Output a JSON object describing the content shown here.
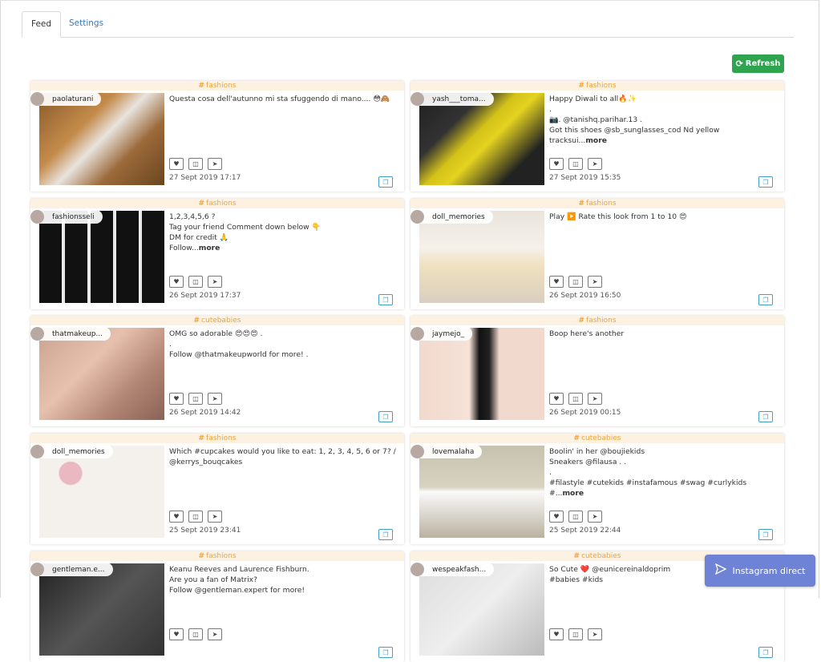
{
  "tabs": [
    {
      "label": "Feed",
      "active": true
    },
    {
      "label": "Settings",
      "active": false
    }
  ],
  "refresh_label": "Refresh",
  "instagram_direct_label": "Instagram direct",
  "colors": {
    "accent_green": "#2ea44f",
    "tag_orange": "#f2a33a",
    "tag_bg": "#fdf2e2",
    "link_blue": "#3b78b8",
    "direct_purple": "#6f83d6"
  },
  "posts": [
    {
      "tag": "fashions",
      "user": "paolaturani",
      "caption": "Questa cosa dell'autunno mi sta sfuggendo di mano.... 😳🙈",
      "more": "",
      "date": "27 Sept 2019 17:17"
    },
    {
      "tag": "fashions",
      "user": "yash___toma...",
      "caption": "Happy Diwali to all🔥✨\n.\n📷. @tanishq.parihar.13 .\nGot this shoes @sb_sunglasses_cod Nd yellow tracksui...",
      "more": "more",
      "date": "27 Sept 2019 15:35"
    },
    {
      "tag": "fashions",
      "user": "fashionsseli",
      "caption": "1,2,3,4,5,6 ?\nTag your friend Comment down below 👇\nDM for credit 🙏\nFollow...",
      "more": "more",
      "date": "26 Sept 2019 17:37"
    },
    {
      "tag": "fashions",
      "user": "doll_memories",
      "caption": "Play ▶️ Rate this look from 1 to 10 😍",
      "more": "",
      "date": "26 Sept 2019 16:50"
    },
    {
      "tag": "cutebabies",
      "user": "thatmakeup...",
      "caption": "OMG so adorable 😍😍😍 .\n.\nFollow @thatmakeupworld for more! .",
      "more": "",
      "date": "26 Sept 2019 14:42"
    },
    {
      "tag": "fashions",
      "user": "jaymejo_",
      "caption": "Boop here's another",
      "more": "",
      "date": "26 Sept 2019 00:15"
    },
    {
      "tag": "fashions",
      "user": "doll_memories",
      "caption": "Which #cupcakes would you like to eat: 1, 2, 3, 4, 5, 6 or 7? /\n@kerrys_bouqcakes",
      "more": "",
      "date": "25 Sept 2019 23:41"
    },
    {
      "tag": "cutebabies",
      "user": "lovemalaha",
      "caption": "Boolin' in her @boujiekids\nSneakers @filausa . .\n.\n#filastyle #cutekids #instafamous #swag #curlykids #...",
      "more": "more",
      "date": "25 Sept 2019 22:44"
    },
    {
      "tag": "fashions",
      "user": "gentleman.e...",
      "caption": "Keanu Reeves and Laurence Fishburn.\nAre you a fan of Matrix?\nFollow @gentleman.expert for more!",
      "more": "",
      "date": ""
    },
    {
      "tag": "cutebabies",
      "user": "wespeakfash...",
      "caption": "So Cute ❤️ @eunicereinaldoprim\n#babies #kids",
      "more": "",
      "date": ""
    }
  ]
}
